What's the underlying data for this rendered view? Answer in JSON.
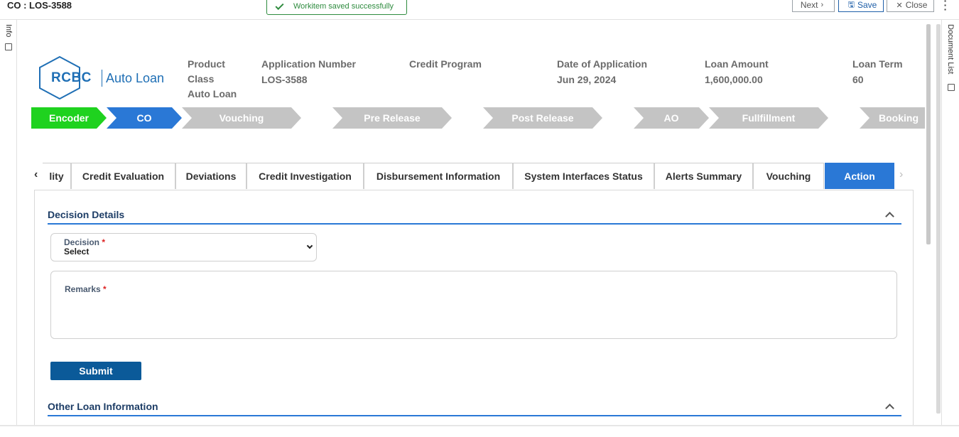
{
  "window": {
    "title": "CO : LOS-3588"
  },
  "toast": {
    "message": "Workitem saved successfully"
  },
  "toolbar": {
    "next_label": "Next",
    "save_label": "Save",
    "close_label": "Close"
  },
  "rails": {
    "left_label": "Info",
    "right_label": "Document List"
  },
  "logo": {
    "brand": "RCBC",
    "product": "Auto Loan"
  },
  "header": {
    "product_class_label_1": "Product",
    "product_class_label_2": "Class",
    "product_class_value": "Auto Loan",
    "application_number_label": "Application Number",
    "application_number_value": "LOS-3588",
    "credit_program_label": "Credit Program",
    "credit_program_value": "",
    "date_label": "Date of Application",
    "date_value": "Jun 29, 2024",
    "loan_amount_label": "Loan Amount",
    "loan_amount_value": "1,600,000.00",
    "loan_term_label": "Loan Term",
    "loan_term_value": "60"
  },
  "workflow": {
    "steps": [
      {
        "label": "Encoder",
        "state": "done"
      },
      {
        "label": "CO",
        "state": "active"
      },
      {
        "label": "Vouching",
        "state": "todo"
      },
      {
        "label": "Pre Release",
        "state": "todo"
      },
      {
        "label": "Post Release",
        "state": "todo"
      },
      {
        "label": "AO",
        "state": "todo"
      },
      {
        "label": "Fullfillment",
        "state": "todo"
      },
      {
        "label": "Booking",
        "state": "todo"
      }
    ],
    "colors": {
      "done": "#1fd21f",
      "active": "#2a78d6",
      "todo": "#c4c4c4"
    }
  },
  "tabs": {
    "items": [
      {
        "label": "lity"
      },
      {
        "label": "Credit Evaluation"
      },
      {
        "label": "Deviations"
      },
      {
        "label": "Credit Investigation"
      },
      {
        "label": "Disbursement Information"
      },
      {
        "label": "System Interfaces Status"
      },
      {
        "label": "Alerts Summary"
      },
      {
        "label": "Vouching"
      },
      {
        "label": "Action"
      }
    ],
    "active": "Action",
    "prev_icon": "chevron-left-icon",
    "next_icon": "chevron-right-icon"
  },
  "decision_details": {
    "title": "Decision Details",
    "decision_label": "Decision",
    "decision_required": "*",
    "decision_value": "Select",
    "remarks_label": "Remarks",
    "remarks_required": "*",
    "submit_label": "Submit"
  },
  "other_info": {
    "title": "Other Loan Information"
  }
}
